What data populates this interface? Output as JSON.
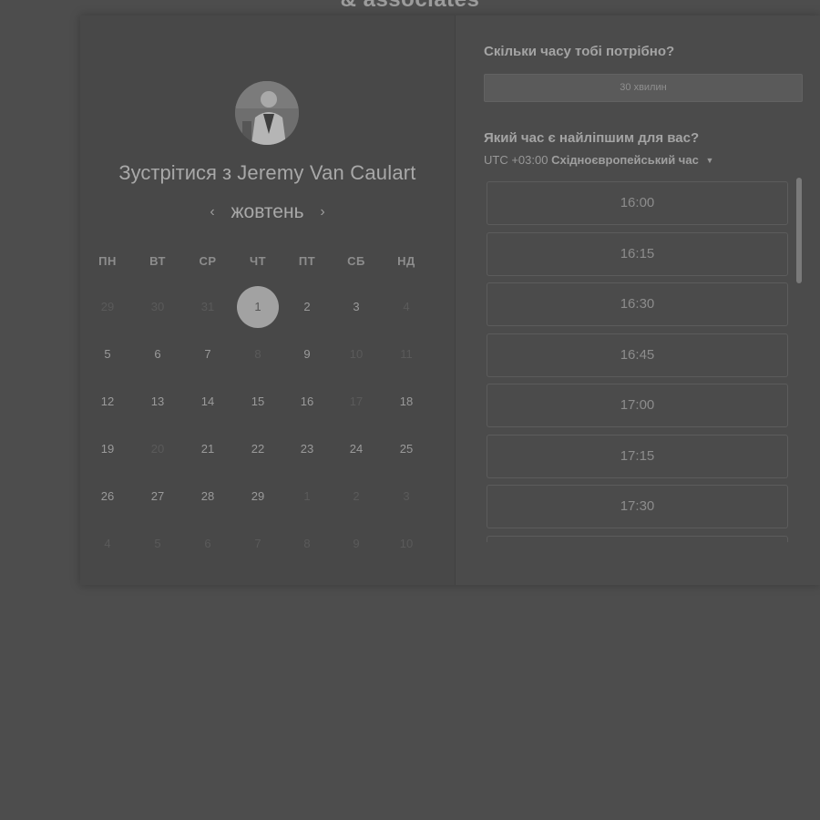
{
  "page": {
    "top_title": "& associates"
  },
  "scheduler": {
    "meet_prefix": "Зустрітися з",
    "host_name": "Jeremy Van Caulart",
    "month": "жовтень",
    "prev_icon": "‹",
    "next_icon": "›",
    "weekdays": [
      "ПН",
      "ВТ",
      "СР",
      "ЧТ",
      "ПТ",
      "СБ",
      "НД"
    ],
    "weeks": [
      [
        {
          "d": "29",
          "m": true
        },
        {
          "d": "30",
          "m": true
        },
        {
          "d": "31",
          "m": true
        },
        {
          "d": "1",
          "sel": true
        },
        {
          "d": "2"
        },
        {
          "d": "3"
        },
        {
          "d": "4",
          "m": true
        }
      ],
      [
        {
          "d": "5"
        },
        {
          "d": "6"
        },
        {
          "d": "7"
        },
        {
          "d": "8",
          "m": true
        },
        {
          "d": "9"
        },
        {
          "d": "10",
          "m": true
        },
        {
          "d": "11",
          "m": true
        }
      ],
      [
        {
          "d": "12"
        },
        {
          "d": "13"
        },
        {
          "d": "14"
        },
        {
          "d": "15"
        },
        {
          "d": "16"
        },
        {
          "d": "17",
          "m": true
        },
        {
          "d": "18"
        }
      ],
      [
        {
          "d": "19"
        },
        {
          "d": "20",
          "m": true
        },
        {
          "d": "21"
        },
        {
          "d": "22"
        },
        {
          "d": "23"
        },
        {
          "d": "24"
        },
        {
          "d": "25"
        }
      ],
      [
        {
          "d": "26"
        },
        {
          "d": "27"
        },
        {
          "d": "28"
        },
        {
          "d": "29"
        },
        {
          "d": "1",
          "m": true
        },
        {
          "d": "2",
          "m": true
        },
        {
          "d": "3",
          "m": true
        }
      ],
      [
        {
          "d": "4",
          "m": true
        },
        {
          "d": "5",
          "m": true
        },
        {
          "d": "6",
          "m": true
        },
        {
          "d": "7",
          "m": true
        },
        {
          "d": "8",
          "m": true
        },
        {
          "d": "9",
          "m": true
        },
        {
          "d": "10",
          "m": true
        }
      ]
    ]
  },
  "booking": {
    "duration_question": "Скільки часу тобі потрібно?",
    "duration_value": "30 хвилин",
    "time_question": "Який час є найліпшим для вас?",
    "tz_offset": "UTC +03:00",
    "tz_name": "Східноєвропейський час",
    "slots": [
      "16:00",
      "16:15",
      "16:30",
      "16:45",
      "17:00",
      "17:15",
      "17:30",
      ""
    ]
  }
}
